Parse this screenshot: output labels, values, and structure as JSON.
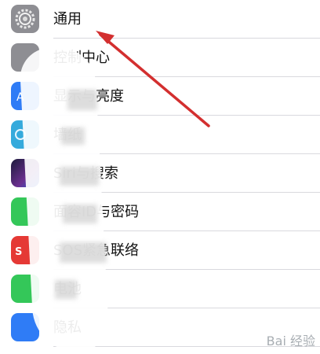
{
  "settings": {
    "rows": [
      {
        "label": "通用",
        "icon": "gear-icon",
        "color": "#8e8e93"
      },
      {
        "label": "控制中心",
        "icon": "control-center-icon",
        "color": "#8e8e93"
      },
      {
        "label": "显示与亮度",
        "icon": "display-brightness-icon",
        "color": "#2f7cf6"
      },
      {
        "label": "墙纸",
        "icon": "wallpaper-icon",
        "color": "#35aadc"
      },
      {
        "label": "Siri与搜索",
        "icon": "siri-icon",
        "color": "#3b2f6b"
      },
      {
        "label": "面容ID与密码",
        "icon": "face-id-icon",
        "color": "#34c759"
      },
      {
        "label": "SOS紧急联络",
        "icon": "sos-icon",
        "color": "#e53935"
      },
      {
        "label": "电池",
        "icon": "battery-icon",
        "color": "#34c759"
      },
      {
        "label": "隐私",
        "icon": "privacy-icon",
        "color": "#2f7cf6"
      }
    ]
  },
  "watermark": {
    "text": "Bai 经验"
  }
}
